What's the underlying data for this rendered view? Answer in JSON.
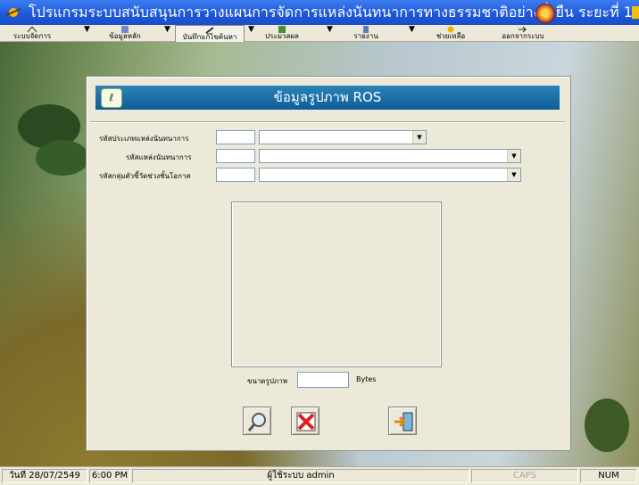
{
  "window": {
    "title": "โปรแกรมระบบสนับสนุนการวางแผนการจัดการแหล่งนันทนาการทางธรรมชาติอย่างยั่งยืน ระยะที่ 1"
  },
  "menu": [
    {
      "label": "ระบบจัดการ",
      "icon": "system-icon"
    },
    {
      "label": "ข้อมูลหลัก",
      "icon": "data-icon"
    },
    {
      "label": "บันทึกแก้ไขค้นหา",
      "icon": "edit-search-icon"
    },
    {
      "label": "ประมวลผล",
      "icon": "process-icon"
    },
    {
      "label": "รายงาน",
      "icon": "report-icon"
    },
    {
      "label": "ช่วยเหลือ",
      "icon": "help-icon"
    },
    {
      "label": "ออกจากระบบ",
      "icon": "exit-icon"
    }
  ],
  "form": {
    "title": "ข้อมูลรูปภาพ ROS",
    "fields": [
      {
        "label": "รหัสประเภทแหล่งนันทนาการ",
        "code": "",
        "value": ""
      },
      {
        "label": "รหัสแหล่งนันทนาการ",
        "code": "",
        "value": ""
      },
      {
        "label": "รหัสกลุ่มตัวชี้วัดช่วงชั้นโอกาส",
        "code": "",
        "value": ""
      }
    ],
    "size_label": "ขนาดรูปภาพ",
    "size_value": "",
    "size_unit": "Bytes",
    "buttons": [
      {
        "name": "search",
        "icon": "magnifier-icon"
      },
      {
        "name": "delete",
        "icon": "delete-x-icon"
      },
      {
        "name": "exit",
        "icon": "exit-door-icon"
      }
    ]
  },
  "status": {
    "date": "วันที่ 28/07/2549",
    "time": "6:00 PM",
    "user": "ผู้ใช้ระบบ admin",
    "caps": "CAPS",
    "num": "NUM"
  },
  "colors": {
    "header": "#1766a8",
    "titlebar": "#1d56d8"
  }
}
